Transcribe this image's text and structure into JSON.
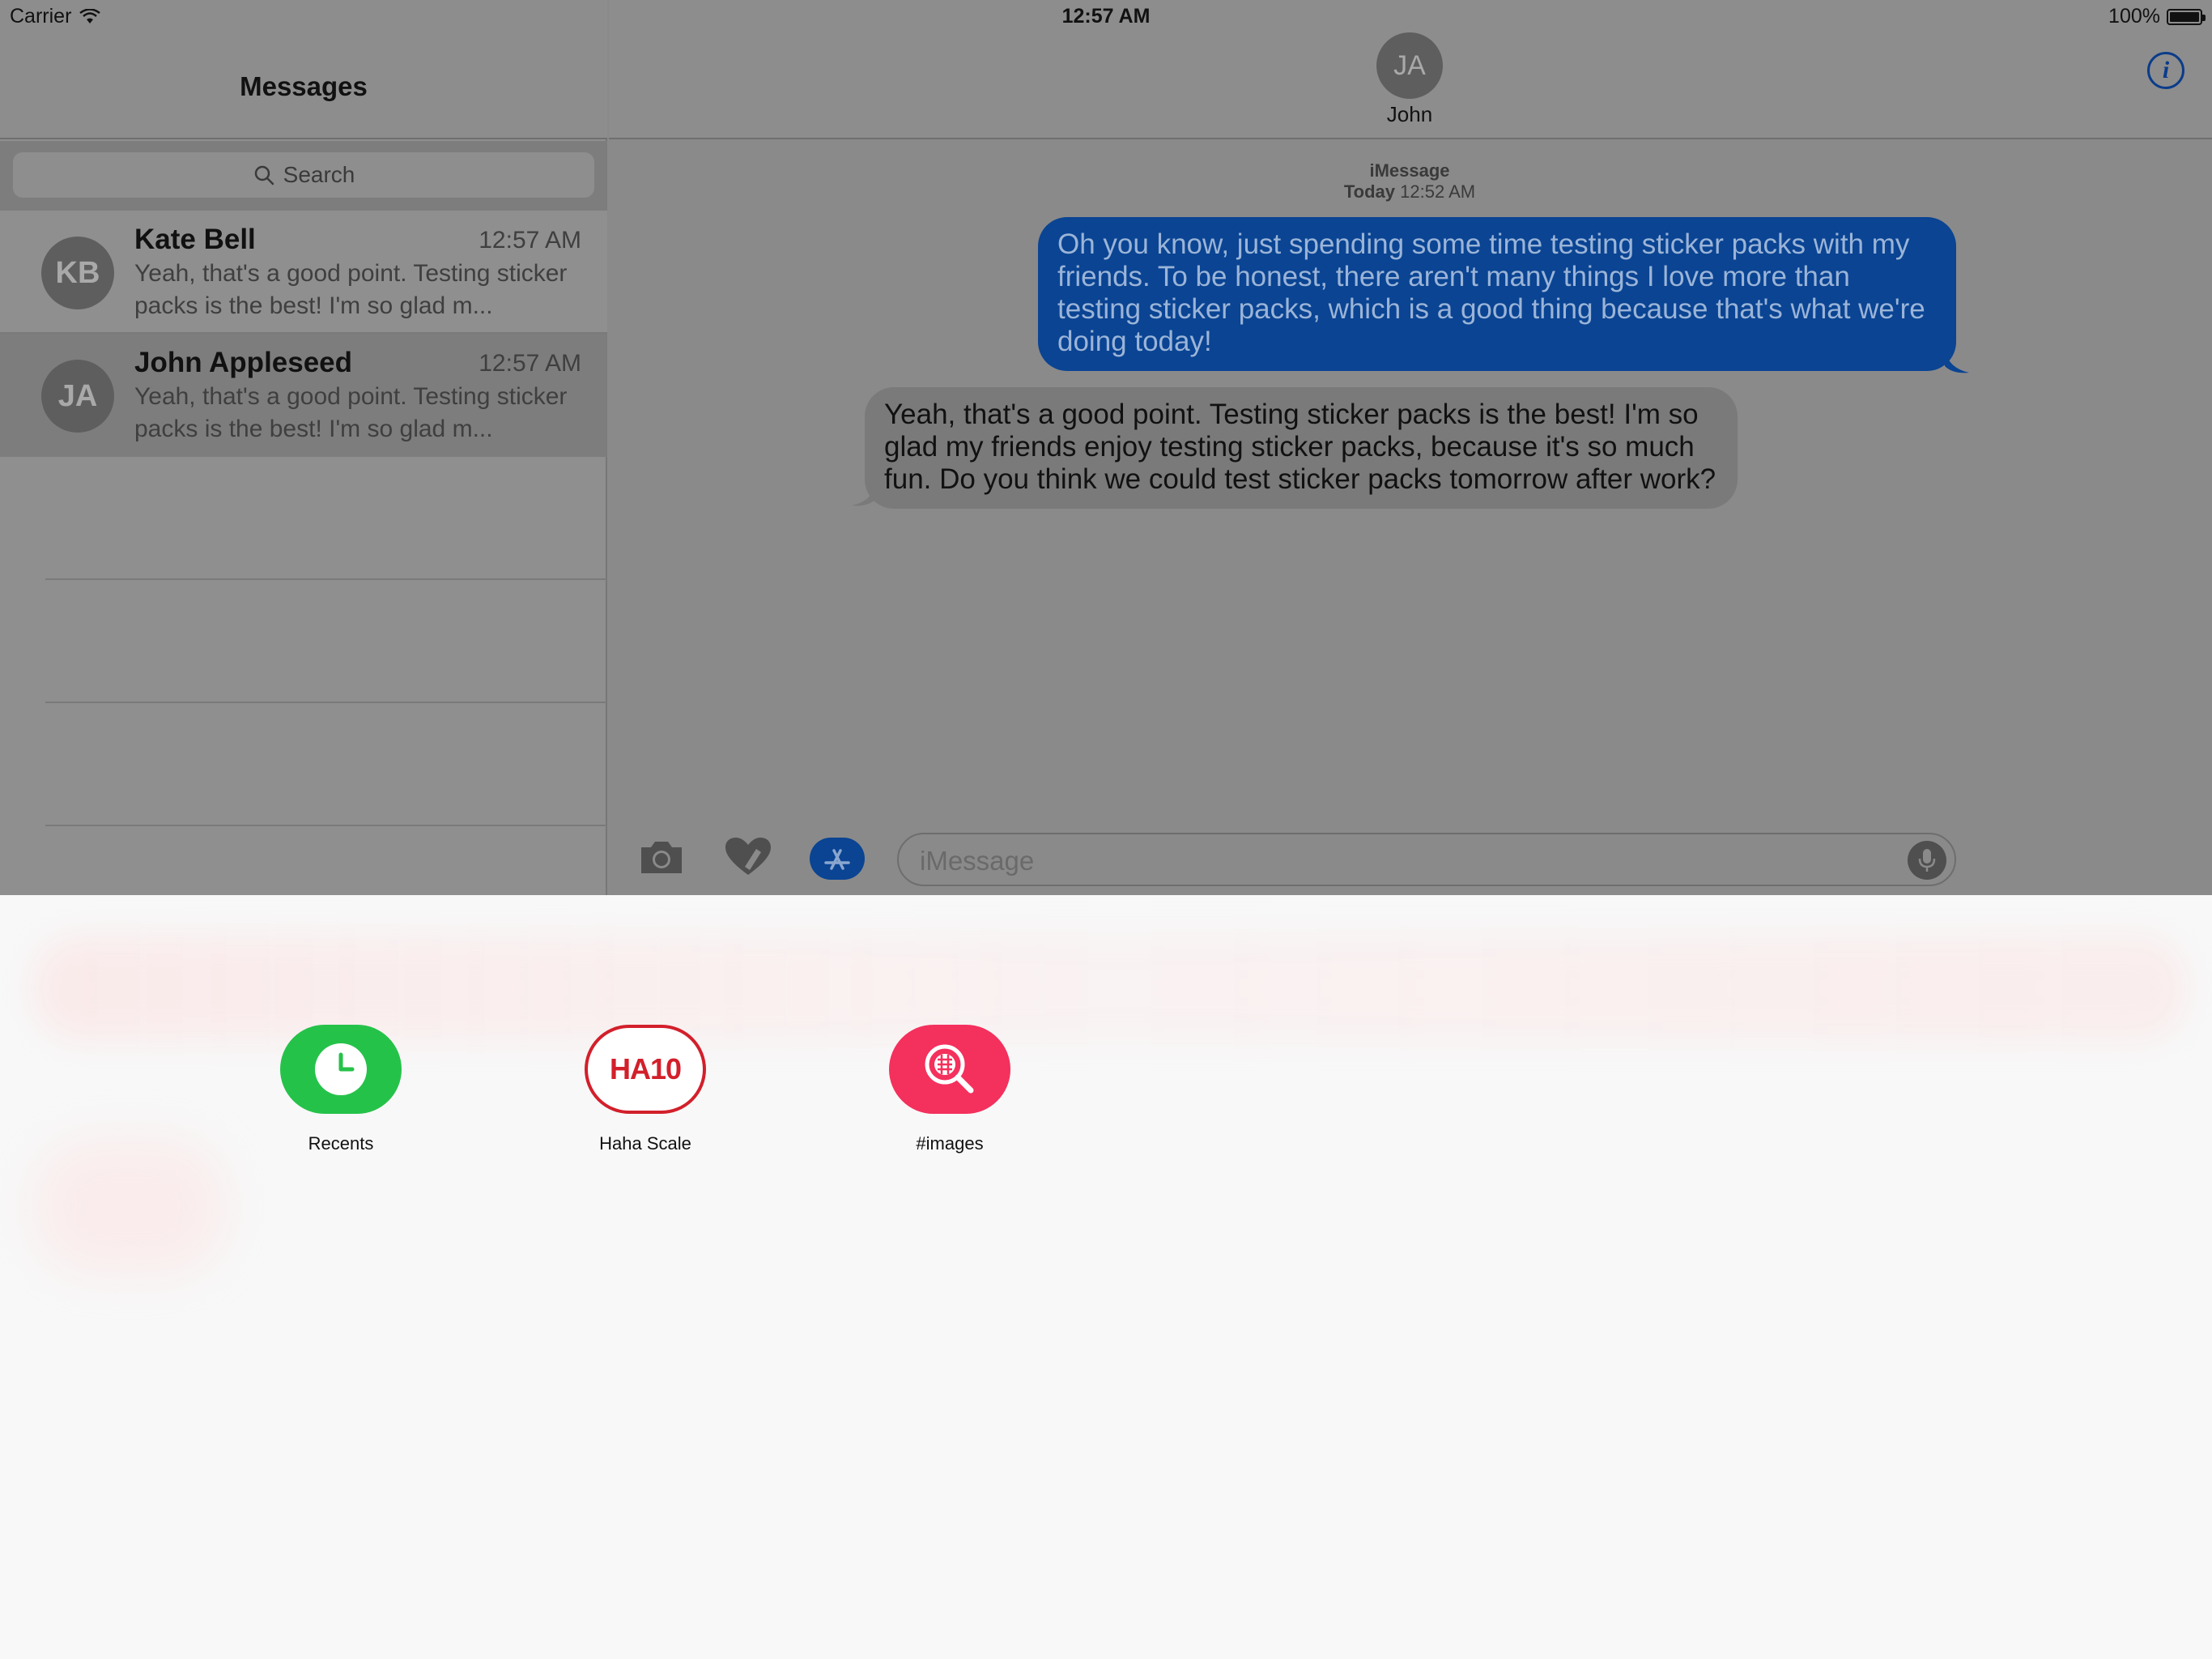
{
  "status_bar": {
    "carrier": "Carrier",
    "time": "12:57 AM",
    "battery": "100%"
  },
  "sidebar": {
    "title": "Messages",
    "search_placeholder": "Search",
    "conversations": [
      {
        "initials": "KB",
        "name": "Kate Bell",
        "time": "12:57 AM",
        "preview": "Yeah, that's a good point. Testing sticker packs is the best! I'm so glad m..."
      },
      {
        "initials": "JA",
        "name": "John Appleseed",
        "time": "12:57 AM",
        "preview": "Yeah, that's a good point. Testing sticker packs is the best! I'm so glad m..."
      }
    ]
  },
  "chat": {
    "contact_initials": "JA",
    "contact_name": "John",
    "service": "iMessage",
    "date_label": "Today",
    "date_time": "12:52 AM",
    "messages": [
      {
        "direction": "outgoing",
        "text": "Oh you know, just spending some time testing sticker packs with my friends. To be honest, there aren't many things I love more than testing sticker packs, which is a good thing because that's what we're doing today!"
      },
      {
        "direction": "incoming",
        "text": "Yeah, that's a good point. Testing sticker packs is the best! I'm so glad my friends enjoy testing sticker packs, because it's so much fun. Do you think we could test sticker packs tomorrow after work?"
      }
    ],
    "input_placeholder": "iMessage"
  },
  "drawer": {
    "apps": [
      {
        "label": "Recents",
        "icon": "clock-icon",
        "color": "#25c24a"
      },
      {
        "label": "Haha Scale",
        "icon": "HA10",
        "color": "#d2202b"
      },
      {
        "label": "#images",
        "icon": "globe-search-icon",
        "color": "#f4305d"
      }
    ]
  },
  "colors": {
    "accent_blue": "#0a4493",
    "dim_overlay": "#8a8a8a"
  }
}
